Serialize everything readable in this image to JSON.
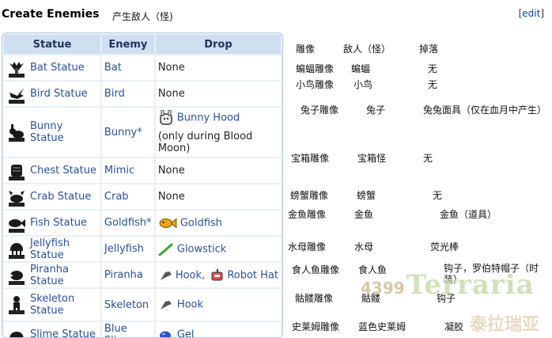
{
  "heading": "Create Enemies",
  "heading_cn": "产生敌人（怪)",
  "edit": {
    "open": "[",
    "label": "edit",
    "close": "]"
  },
  "table": {
    "headers": [
      "Statue",
      "Enemy",
      "Drop"
    ],
    "rows": [
      {
        "statue": "Bat Statue",
        "enemy": "Bat",
        "drop": "None",
        "icon": "bat-statue-icon"
      },
      {
        "statue": "Bird Statue",
        "enemy": "Bird",
        "drop": "None",
        "icon": "bird-statue-icon"
      },
      {
        "statue": "Bunny Statue",
        "enemy": "Bunny*",
        "drop": "Bunny Hood",
        "drop_note": "(only during Blood Moon)",
        "icon": "bunny-statue-icon"
      },
      {
        "statue": "Chest Statue",
        "enemy": "Mimic",
        "drop": "None",
        "icon": "chest-statue-icon"
      },
      {
        "statue": "Crab Statue",
        "enemy": "Crab",
        "drop": "None",
        "icon": "crab-statue-icon"
      },
      {
        "statue": "Fish Statue",
        "enemy": "Goldfish*",
        "drop": "Goldfish",
        "icon": "fish-statue-icon"
      },
      {
        "statue": "Jellyfish Statue",
        "enemy": "Jellyfish",
        "drop": "Glowstick",
        "icon": "jellyfish-statue-icon"
      },
      {
        "statue": "Piranha Statue",
        "enemy": "Piranha",
        "drop": "Hook,",
        "drop2": "Robot Hat",
        "icon": "piranha-statue-icon"
      },
      {
        "statue": "Skeleton Statue",
        "enemy": "Skeleton",
        "drop": "Hook",
        "icon": "skeleton-statue-icon"
      },
      {
        "statue": "Slime Statue",
        "enemy": "Blue Slime",
        "drop": "Gel",
        "icon": "slime-statue-icon"
      }
    ]
  },
  "translations": {
    "header": [
      "雕像",
      "敌人（怪）",
      "掉落"
    ],
    "rows": [
      [
        "蝙蝠雕像",
        "蝙蝠",
        "无"
      ],
      [
        "小鸟雕像",
        "小鸟",
        "无"
      ],
      [
        "兔子雕像",
        "兔子",
        "兔兔面具（仅在血月中产生）"
      ],
      [
        "宝箱雕像",
        "宝箱怪",
        "无"
      ],
      [
        "螃蟹雕像",
        "螃蟹",
        "无"
      ],
      [
        "金鱼雕像",
        "金鱼",
        "金鱼（道具）"
      ],
      [
        "水母雕像",
        "水母",
        "荧光棒"
      ],
      [
        "食人鱼雕像",
        "食人鱼",
        "钩子，罗伯特帽子（时装）"
      ],
      [
        "骷髅雕像",
        "骷髅",
        "钩子"
      ],
      [
        "史莱姆雕像",
        "蓝色史莱姆",
        "凝胶"
      ]
    ]
  },
  "watermark": {
    "site": "4399",
    "title": "Terraria",
    "subtitle": "泰拉瑞亚"
  }
}
